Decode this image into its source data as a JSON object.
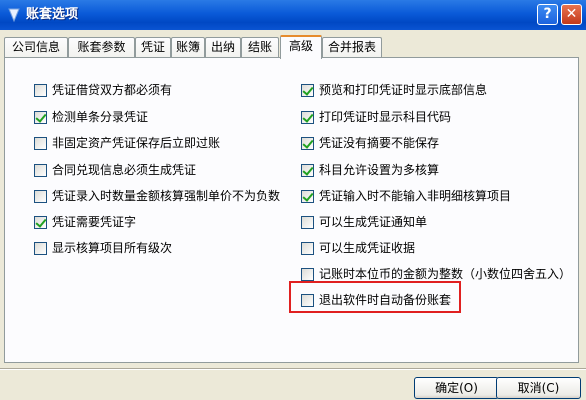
{
  "window": {
    "title": "账套选项",
    "help_btn": "?",
    "close_btn": "✕"
  },
  "tabs": [
    {
      "label": "公司信息"
    },
    {
      "label": "账套参数"
    },
    {
      "label": "凭证"
    },
    {
      "label": "账簿"
    },
    {
      "label": "出纳"
    },
    {
      "label": "结账"
    },
    {
      "label": "高级",
      "active": true
    },
    {
      "label": "合并报表"
    }
  ],
  "options_left": [
    {
      "label": "凭证借贷双方都必须有",
      "checked": false
    },
    {
      "label": "检测单条分录凭证",
      "checked": true
    },
    {
      "label": "非固定资产凭证保存后立即过账",
      "checked": false
    },
    {
      "label": "合同兑现信息必须生成凭证",
      "checked": false
    },
    {
      "label": "凭证录入时数量金额核算强制单价不为负数",
      "checked": false
    },
    {
      "label": "凭证需要凭证字",
      "checked": true
    },
    {
      "label": "显示核算项目所有级次",
      "checked": false
    }
  ],
  "options_right": [
    {
      "label": "预览和打印凭证时显示底部信息",
      "checked": true
    },
    {
      "label": "打印凭证时显示科目代码",
      "checked": true
    },
    {
      "label": "凭证没有摘要不能保存",
      "checked": true
    },
    {
      "label": "科目允许设置为多核算",
      "checked": true
    },
    {
      "label": "凭证输入时不能输入非明细核算项目",
      "checked": true
    },
    {
      "label": "可以生成凭证通知单",
      "checked": false
    },
    {
      "label": "可以生成凭证收据",
      "checked": false
    },
    {
      "label": "记账时本位币的金额为整数（小数位四舍五入）",
      "checked": false
    },
    {
      "label": "退出软件时自动备份账套",
      "checked": false
    }
  ],
  "buttons": {
    "ok": "确定(O)",
    "cancel": "取消(C)"
  },
  "colors": {
    "title_bar": "#0a5ad8",
    "highlight": "#e02020",
    "check": "#21a121"
  }
}
